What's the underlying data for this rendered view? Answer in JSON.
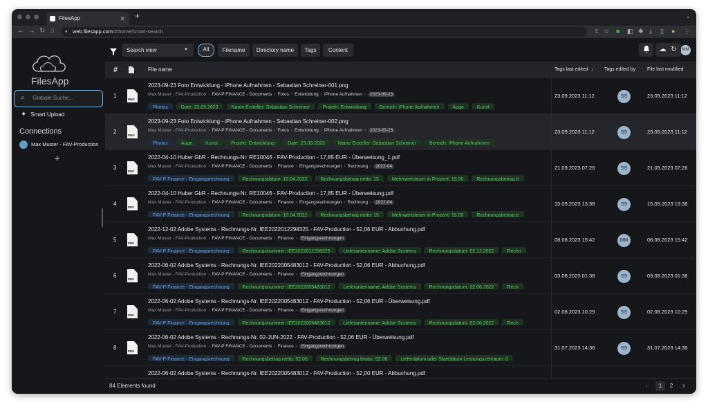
{
  "browser": {
    "tab_title": "FilesApp",
    "url_host": "web.filesapp.com",
    "url_path": "/#/home/smart-search"
  },
  "sidebar": {
    "logo_text": "FilesApp",
    "search_placeholder": "Globale Suche...",
    "smart_upload": "Smart Upload",
    "connections_title": "Connections",
    "connection_name": "Max Muster - FAV-Production",
    "add_label": "+"
  },
  "toolbar": {
    "view_select": "Search view",
    "chips": [
      "All",
      "Filename",
      "Directory name",
      "Tags",
      "Content"
    ],
    "user_initials": "MM"
  },
  "table": {
    "headers": {
      "num": "#",
      "name": "File name",
      "tags_last_edited": "Tags last edited",
      "tags_edited_by": "Tags edited by",
      "file_last_modified": "File last modified"
    },
    "rows": [
      {
        "num": "1",
        "type": "PNG",
        "name": "2023-09-23 Foto Entwicklung - iPhone Aufnahmen - Sebastian Schreiner-001.png",
        "path": [
          "Max Muster - FAV-Production",
          "FAV-P FINANCE - Documents",
          "Fotos",
          "Entwicklung",
          "iPhone Aufnahmen",
          "2023-09-23"
        ],
        "tags": [
          {
            "t": "Photos",
            "c": "b"
          },
          {
            "t": "Date: 23.09.2023",
            "c": "g"
          },
          {
            "t": "Name Ersteller: Sebastian Schreiner",
            "c": "g"
          },
          {
            "t": "Projekt: Entwicklung",
            "c": "g"
          },
          {
            "t": "Bereich: iPhone Aufnahmen",
            "c": "g"
          },
          {
            "t": "Auge",
            "c": "g"
          },
          {
            "t": "Kunst",
            "c": "g"
          }
        ],
        "tags_last_edited": "23.09.2023 11:12",
        "edited_by": "SS",
        "file_last_modified": "23.09.2023 11:12"
      },
      {
        "num": "2",
        "type": "PNG",
        "name": "2023-09-23 Foto Entwicklung - iPhone Aufnahmen - Sebastian Schreiner-002.png",
        "path": [
          "Max Muster - FAV-Production",
          "FAV-P FINANCE - Documents",
          "Fotos",
          "Entwicklung",
          "iPhone Aufnahmen",
          "2023-09-23"
        ],
        "tags": [
          {
            "t": "Photos",
            "c": "b"
          },
          {
            "t": "Auge",
            "c": "g"
          },
          {
            "t": "Kunst",
            "c": "g"
          },
          {
            "t": "Projekt: Entwicklung",
            "c": "g"
          },
          {
            "t": "Date: 23.09.2023",
            "c": "g"
          },
          {
            "t": "Name Ersteller: Sebastian Schreiner",
            "c": "g"
          },
          {
            "t": "Bereich: iPhone Aufnahmen",
            "c": "g"
          }
        ],
        "tags_last_edited": "23.09.2023 11:12",
        "edited_by": "SS",
        "file_last_modified": "23.09.2023 11:12"
      },
      {
        "num": "3",
        "type": "PDF",
        "name": "2022-04-10 Huber GbR - Rechnungs-Nr. RE10046 - FAV-Production - 17,85 EUR - Überweisung_1.pdf",
        "path": [
          "Max Muster - FAV-Production",
          "FAV-P FINANCE - Documents",
          "Finance",
          "Eingangsrechnungen",
          "Rechnung",
          "2022-04"
        ],
        "tags": [
          {
            "t": "FAV-P Finance - Eingangsrechnung",
            "c": "b"
          },
          {
            "t": "Rechnungsdatum: 10.04.2022",
            "c": "g"
          },
          {
            "t": "Rechnungsbetrag netto: 15",
            "c": "g"
          },
          {
            "t": "Mehrwertsteuer in Prozent: 19.00",
            "c": "g"
          },
          {
            "t": "Rechnungsbetrag b",
            "c": "g"
          }
        ],
        "tags_last_edited": "21.09.2023 07:26",
        "edited_by": "SS",
        "file_last_modified": "21.09.2023 07:26"
      },
      {
        "num": "4",
        "type": "PDF",
        "name": "2022-04-10 Huber GbR - Rechnungs-Nr. RE10046 - FAV-Production - 17,85 EUR - Überweisung.pdf",
        "path": [
          "Max Muster - FAV-Production",
          "FAV-P FINANCE - Documents",
          "Finance",
          "Eingangsrechnungen",
          "Rechnung",
          "2022-04"
        ],
        "tags": [
          {
            "t": "FAV-P Finance - Eingangsrechnung",
            "c": "b"
          },
          {
            "t": "Rechnungsdatum: 10.04.2022",
            "c": "g"
          },
          {
            "t": "Rechnungsbetrag netto: 15",
            "c": "g"
          },
          {
            "t": "Mehrwertsteuer in Prozent: 19.00",
            "c": "g"
          },
          {
            "t": "Rechnungsbetrag b",
            "c": "g"
          }
        ],
        "tags_last_edited": "15.09.2023 13:38",
        "edited_by": "SS",
        "file_last_modified": "15.09.2023 13:38"
      },
      {
        "num": "5",
        "type": "PDF",
        "name": "2022-12-02 Adobe Systems - Rechnungs-Nr. IEE2022012298325 - FAV-Production - 52,06 EUR - Abbuchung.pdf",
        "path": [
          "Max Muster - FAV-Production",
          "FAV-P FINANCE - Documents",
          "Finance",
          "Eingangsrechnungen"
        ],
        "tags": [
          {
            "t": "FAV-P Finance - Eingangsrechnung",
            "c": "b"
          },
          {
            "t": "Rechnungsnummer: IEE2022012298325",
            "c": "g"
          },
          {
            "t": "Lieferantenname: Adobe Systems",
            "c": "g"
          },
          {
            "t": "Rechnungsdatum: 02.12.2022",
            "c": "g"
          },
          {
            "t": "Rechn",
            "c": "g"
          }
        ],
        "tags_last_edited": "08.08.2023 15:42",
        "edited_by": "MM",
        "file_last_modified": "08.08.2023 15:42"
      },
      {
        "num": "6",
        "type": "PDF",
        "name": "2022-06-02 Adobe Systems - Rechnungs-Nr. IEE2022005483012 - FAV-Production - 52,06 EUR - Abbuchung.pdf",
        "path": [
          "Max Muster - FAV-Production",
          "FAV-P FINANCE - Documents",
          "Finance",
          "Eingangsrechnungen"
        ],
        "tags": [
          {
            "t": "FAV-P Finance - Eingangsrechnung",
            "c": "b"
          },
          {
            "t": "Rechnungsnummer: IEE2022005483012",
            "c": "g"
          },
          {
            "t": "Lieferantenname: Adobe Systems",
            "c": "g"
          },
          {
            "t": "Rechnungsdatum: 02.06.2022",
            "c": "g"
          },
          {
            "t": "Rech",
            "c": "g"
          }
        ],
        "tags_last_edited": "03.08.2023 01:38",
        "edited_by": "SS",
        "file_last_modified": "03.08.2023 01:38"
      },
      {
        "num": "7",
        "type": "PDF",
        "name": "2022-06-02 Adobe Systems - Rechnungs-Nr. IEE2022005483012 - FAV-Production - 52,06 EUR - Überweisung.pdf",
        "path": [
          "Max Muster - FAV-Production",
          "FAV-P FINANCE - Documents",
          "Finance",
          "Eingangsrechnungen"
        ],
        "tags": [
          {
            "t": "FAV-P Finance - Eingangsrechnung",
            "c": "b"
          },
          {
            "t": "Rechnungsnummer: IEE2022005483012",
            "c": "g"
          },
          {
            "t": "Lieferantenname: Adobe Systems",
            "c": "g"
          },
          {
            "t": "Rechnungsdatum: 02.06.2022",
            "c": "g"
          },
          {
            "t": "Rech",
            "c": "g"
          }
        ],
        "tags_last_edited": "02.08.2023 10:29",
        "edited_by": "SS",
        "file_last_modified": "02.08.2023 10:29"
      },
      {
        "num": "8",
        "type": "PDF",
        "name": "2022-06-02 Adobe Systems - Rechnungs-Nr. 02-JUN-2022 - FAV-Production - 52,06 EUR - Überweisung.pdf",
        "path": [
          "Max Muster - FAV-Production",
          "FAV-P FINANCE - Documents",
          "Finance",
          "Eingangsrechnungen"
        ],
        "tags": [
          {
            "t": "FAV-P Finance - Eingangsrechnung",
            "c": "b"
          },
          {
            "t": "Rechnungsbetrag netto: 52.06",
            "c": "g"
          },
          {
            "t": "Rechnungsbetrag brutto: 52.06",
            "c": "g"
          },
          {
            "t": "Lieferdatum oder Startdatum Leistungszeitraum: 0",
            "c": "g"
          }
        ],
        "tags_last_edited": "31.07.2023 14:36",
        "edited_by": "SS",
        "file_last_modified": "31.07.2023 14:36"
      },
      {
        "num": "",
        "type": "",
        "name": "2022-06-02 Adobe Systems - Rechnungs-Nr. IEE2022005483012 - FAV-Production - 52,00 EUR - Abbuchung.pdf",
        "path": [],
        "tags": [],
        "tags_last_edited": "",
        "edited_by": "",
        "file_last_modified": ""
      }
    ]
  },
  "footer": {
    "count_text": "84 Elements found",
    "pages": [
      "1",
      "2"
    ],
    "current_page": "1"
  },
  "colors": {
    "accent": "#7ab4ea",
    "tag_green_text": "#5ec466",
    "tag_blue_text": "#6ca2dc",
    "background": "#16171a"
  }
}
